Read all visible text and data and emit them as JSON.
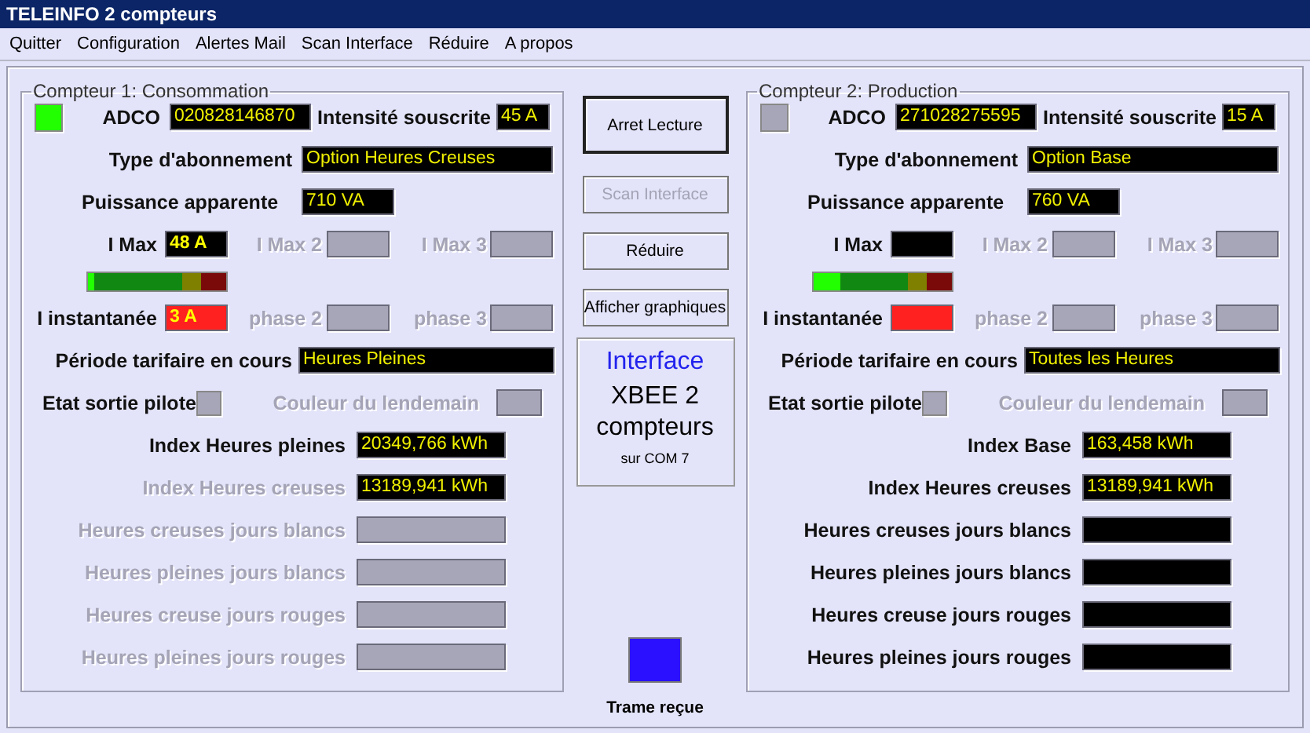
{
  "window": {
    "title": "TELEINFO 2 compteurs"
  },
  "menu": [
    "Quitter",
    "Configuration",
    "Alertes Mail",
    "Scan Interface",
    "Réduire",
    "A propos"
  ],
  "meters": [
    {
      "title": "Compteur 1: Consommation",
      "led": {
        "on": true
      },
      "adco": {
        "label": "ADCO",
        "value": "020828146870"
      },
      "intensite": {
        "label": "Intensité souscrite",
        "value": "45 A"
      },
      "abonnement": {
        "label": "Type d'abonnement",
        "value": "Option Heures Creuses"
      },
      "puissance": {
        "label": "Puissance apparente",
        "value": "710 VA"
      },
      "imax": [
        {
          "label": "I Max",
          "value": "48 A",
          "disabled": false
        },
        {
          "label": "I Max 2",
          "disabled": true
        },
        {
          "label": "I Max 3",
          "disabled": true
        }
      ],
      "gauge": {
        "level": 0.04
      },
      "instant": [
        {
          "label": "I instantanée",
          "value": "3 A",
          "disabled": false,
          "alert": true
        },
        {
          "label": "phase 2",
          "disabled": true,
          "alert": false
        },
        {
          "label": "phase 3",
          "disabled": true,
          "alert": false
        }
      ],
      "periode": {
        "label": "Période tarifaire en cours",
        "value": "Heures Pleines"
      },
      "pilote": {
        "label": "Etat sortie pilote",
        "on": false
      },
      "lendemain": {
        "label": "Couleur du lendemain",
        "disabled": true
      },
      "index": [
        {
          "label": "Index Heures pleines",
          "value": "20349,766 kWh",
          "disabled": false
        },
        {
          "label": "Index Heures creuses",
          "value": "13189,941 kWh",
          "disabled": true
        },
        {
          "label": "Heures creuses jours blancs",
          "disabled": true
        },
        {
          "label": "Heures pleines jours blancs",
          "disabled": true
        },
        {
          "label": "Heures creuse jours rouges",
          "disabled": true
        },
        {
          "label": "Heures pleines jours rouges",
          "disabled": true
        }
      ]
    },
    {
      "title": "Compteur 2: Production",
      "led": {
        "on": false
      },
      "adco": {
        "label": "ADCO",
        "value": "271028275595"
      },
      "intensite": {
        "label": "Intensité souscrite",
        "value": "15 A"
      },
      "abonnement": {
        "label": "Type d'abonnement",
        "value": "Option Base"
      },
      "puissance": {
        "label": "Puissance apparente",
        "value": "760 VA"
      },
      "imax": [
        {
          "label": "I Max",
          "disabled": false
        },
        {
          "label": "I Max 2",
          "disabled": true
        },
        {
          "label": "I Max 3",
          "disabled": true
        }
      ],
      "gauge": {
        "level": 0.19
      },
      "instant": [
        {
          "label": "I instantanée",
          "disabled": false,
          "alert": true
        },
        {
          "label": "phase 2",
          "disabled": true,
          "alert": false
        },
        {
          "label": "phase 3",
          "disabled": true,
          "alert": false
        }
      ],
      "periode": {
        "label": "Période tarifaire en cours",
        "value": "Toutes les Heures"
      },
      "pilote": {
        "label": "Etat sortie pilote",
        "on": false
      },
      "lendemain": {
        "label": "Couleur du lendemain",
        "disabled": true
      },
      "index": [
        {
          "label": "Index Base",
          "value": "163,458 kWh",
          "disabled": false
        },
        {
          "label": "Index Heures creuses",
          "value": "13189,941 kWh",
          "disabled": false
        },
        {
          "label": "Heures creuses jours blancs",
          "disabled": false
        },
        {
          "label": "Heures pleines jours blancs",
          "disabled": false
        },
        {
          "label": "Heures creuse jours rouges",
          "disabled": false
        },
        {
          "label": "Heures pleines jours rouges",
          "disabled": false
        }
      ]
    }
  ],
  "buttons": [
    {
      "label": "Arret Lecture",
      "kind": "default",
      "disabled": false
    },
    {
      "label": "Scan Interface",
      "kind": "normal",
      "disabled": true
    },
    {
      "label": "Réduire",
      "kind": "normal",
      "disabled": false
    },
    {
      "label": "Afficher graphiques",
      "kind": "normal",
      "disabled": false
    }
  ],
  "interface": {
    "heading": "Interface",
    "name": "XBEE 2 compteurs",
    "port": "sur COM 7"
  },
  "trame": {
    "label": "Trame reçue",
    "on": true
  }
}
